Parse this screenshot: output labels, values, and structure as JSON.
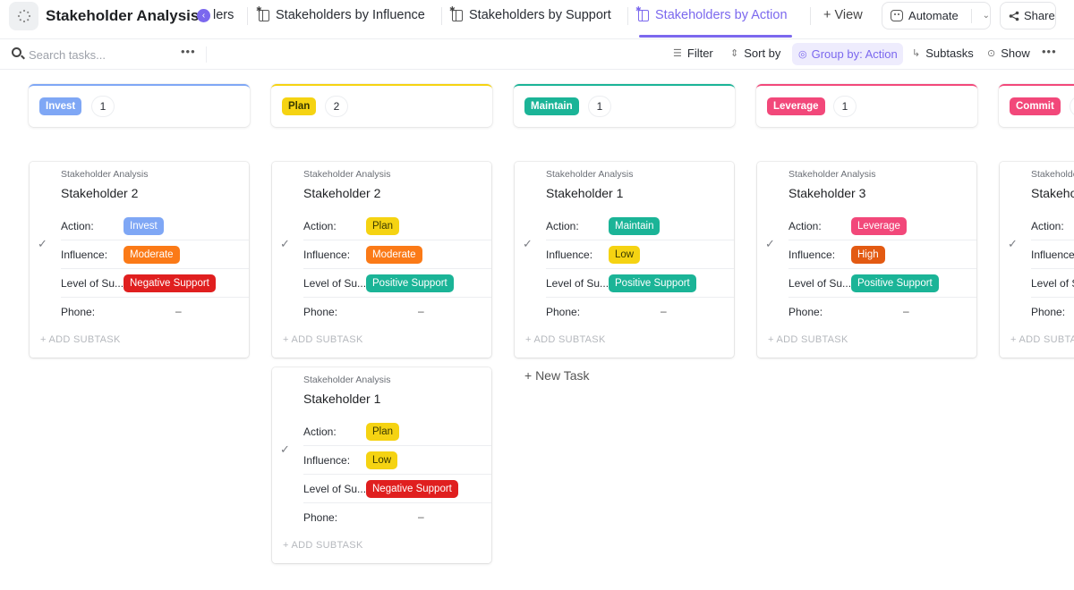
{
  "header": {
    "app_title": "Stakeholder Analysis",
    "truncated_tab": "lers",
    "tabs": [
      {
        "label": "Stakeholders by Influence",
        "active": false
      },
      {
        "label": "Stakeholders by Support",
        "active": false
      },
      {
        "label": "Stakeholders by Action",
        "active": true
      }
    ],
    "add_view_label": "+ View",
    "automate_label": "Automate",
    "share_label": "Share",
    "accent_color": "#7b68ee"
  },
  "toolbar": {
    "search_placeholder": "Search tasks...",
    "search_more": "•••",
    "filter_label": "Filter",
    "sort_label": "Sort by",
    "group_label": "Group by: Action",
    "subtasks_label": "Subtasks",
    "show_label": "Show",
    "more": "•••"
  },
  "columns": [
    {
      "name": "Invest",
      "count": "1",
      "color": "#7fa7f5"
    },
    {
      "name": "Plan",
      "count": "2",
      "color": "#f5d312"
    },
    {
      "name": "Maintain",
      "count": "1",
      "color": "#1bb497"
    },
    {
      "name": "Leverage",
      "count": "1",
      "color": "#f2487a"
    },
    {
      "name": "Commit",
      "count": "",
      "color": "#f2487a"
    }
  ],
  "field_labels": {
    "action": "Action:",
    "influence": "Influence:",
    "support": "Level of Su...",
    "phone": "Phone:",
    "phone_empty": "–",
    "add_subtask": "+ ADD SUBTASK",
    "check": "✓"
  },
  "cards": [
    {
      "list": "Stakeholder Analysis",
      "name": "Stakeholder 2",
      "action": "Invest",
      "influence": "Moderate",
      "support": "Negative Support"
    },
    {
      "list": "Stakeholder Analysis",
      "name": "Stakeholder 2",
      "action": "Plan",
      "influence": "Moderate",
      "support": "Positive Support"
    },
    {
      "list": "Stakeholder Analysis",
      "name": "Stakeholder 1",
      "action": "Plan",
      "influence": "Low",
      "support": "Negative Support"
    },
    {
      "list": "Stakeholder Analysis",
      "name": "Stakeholder 1",
      "action": "Maintain",
      "influence": "Low",
      "support": "Positive Support"
    },
    {
      "list": "Stakeholder Analysis",
      "name": "Stakeholder 3",
      "action": "Leverage",
      "influence": "High",
      "support": "Positive Support"
    },
    {
      "list": "Stakeholde",
      "name": "Stakeho",
      "action": "",
      "influence": "",
      "support": ""
    }
  ],
  "truncated_labels": {
    "influence": "Influence",
    "support": "Level of S",
    "add_subtask": "+ ADD SUBTA"
  },
  "new_task_label": "+ New Task"
}
